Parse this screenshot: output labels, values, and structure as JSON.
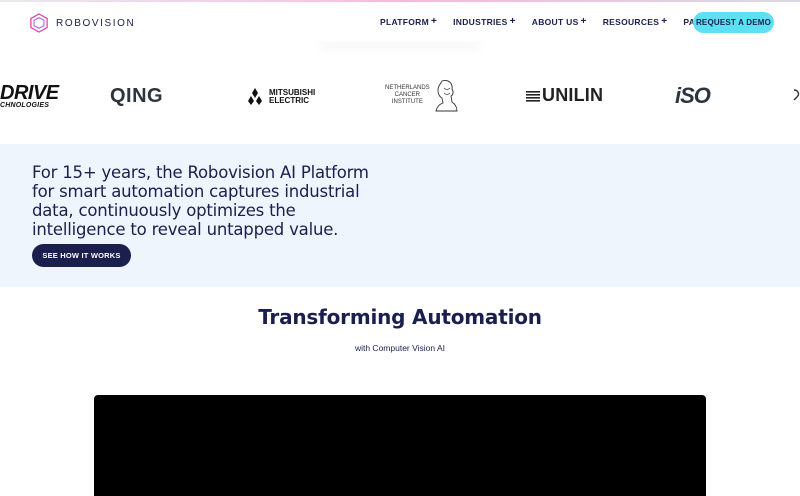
{
  "header": {
    "brand": "ROBOVISION",
    "nav": [
      {
        "label": "PLATFORM",
        "has_plus": true
      },
      {
        "label": "INDUSTRIES",
        "has_plus": true
      },
      {
        "label": "ABOUT US",
        "has_plus": true
      },
      {
        "label": "RESOURCES",
        "has_plus": true
      },
      {
        "label": "PARTNERS",
        "has_plus": false
      }
    ],
    "plus_glyph": "+",
    "cta_label": "REQUEST A DEMO",
    "colors": {
      "cta_bg": "#5de0f2",
      "brand_accent": "#e040a0",
      "navy": "#1a1f4d"
    }
  },
  "logos": {
    "drive": {
      "big": "DRIVE",
      "small": "CHNOLOGIES"
    },
    "qing": "QING",
    "mitsubishi": {
      "line1": "MITSUBISHI",
      "line2": "ELECTRIC"
    },
    "nci": {
      "line1": "NETHERLANDS",
      "line2": "CANCER",
      "line3": "INSTITUTE"
    },
    "unilin": {
      "name": "UNILIN"
    },
    "iso": "iSO"
  },
  "hero": {
    "text": "For 15+ years, the Robovision AI Platform for smart automation captures industrial data, continuously optimizes the intelligence to reveal untapped value.",
    "button_label": "SEE HOW IT WORKS",
    "bg": "#eef5fd"
  },
  "section": {
    "title": "Transforming Automation",
    "subtitle": "with Computer Vision AI"
  }
}
